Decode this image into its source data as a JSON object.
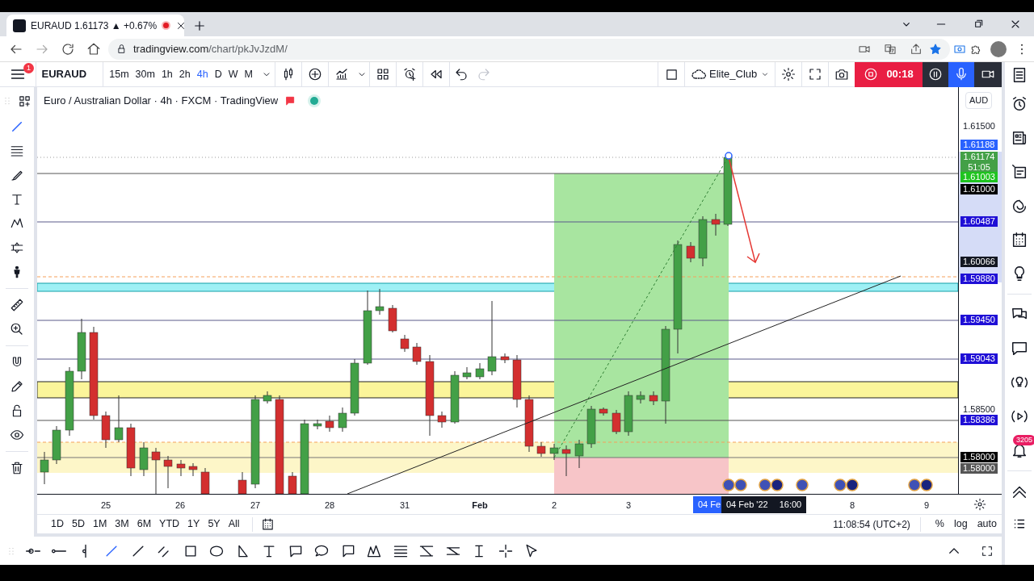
{
  "browser": {
    "tab_title": "EURAUD 1.61173 ▲ +0.67%",
    "url": {
      "host": "tradingview.com",
      "path": "/chart/pkJvJzdM/"
    }
  },
  "toolbar": {
    "menu_badge": "1",
    "symbol": "EURAUD",
    "intervals": [
      {
        "label": "15m",
        "selected": false
      },
      {
        "label": "30m",
        "selected": false
      },
      {
        "label": "1h",
        "selected": false
      },
      {
        "label": "2h",
        "selected": false
      },
      {
        "label": "4h",
        "selected": true
      },
      {
        "label": "D",
        "selected": false
      },
      {
        "label": "W",
        "selected": false
      },
      {
        "label": "M",
        "selected": false
      }
    ],
    "layout_name": "Elite_Club",
    "recorder_time": "00:18"
  },
  "legend": {
    "title": "Euro / Australian Dollar · 4h · FXCM · TradingView"
  },
  "price_axis": {
    "currency": "AUD",
    "labels": [
      {
        "text": "1.61500",
        "kind": "tick"
      },
      {
        "text": "1.61188",
        "kind": "marker",
        "color": "#2962ff"
      },
      {
        "text": "1.61174",
        "kind": "countdown",
        "countdown": "51:05",
        "color": "#43a047"
      },
      {
        "text": "1.61003",
        "kind": "marker",
        "color": "#1fc41f"
      },
      {
        "text": "1.61000",
        "kind": "marker",
        "color": "#000000"
      },
      {
        "text": "1.60487",
        "kind": "marker",
        "color": "#1f0fd6"
      },
      {
        "text": "1.60066",
        "kind": "marker",
        "color": "#131722"
      },
      {
        "text": "1.59880",
        "kind": "marker",
        "color": "#1f0fd6"
      },
      {
        "text": "1.59450",
        "kind": "marker",
        "color": "#1f0fd6"
      },
      {
        "text": "1.59043",
        "kind": "marker",
        "color": "#1f0fd6"
      },
      {
        "text": "1.58500",
        "kind": "tick"
      },
      {
        "text": "1.58386",
        "kind": "marker",
        "color": "#1f0fd6"
      },
      {
        "text": "1.58000",
        "kind": "marker",
        "color": "#000000"
      },
      {
        "text": "1.58000",
        "kind": "marker",
        "color": "#555555"
      }
    ]
  },
  "time_axis": {
    "labels": [
      {
        "text": "25",
        "kind": "day"
      },
      {
        "text": "26",
        "kind": "day"
      },
      {
        "text": "27",
        "kind": "day"
      },
      {
        "text": "28",
        "kind": "day"
      },
      {
        "text": "31",
        "kind": "day"
      },
      {
        "text": "Feb",
        "kind": "month"
      },
      {
        "text": "2",
        "kind": "day"
      },
      {
        "text": "3",
        "kind": "day"
      },
      {
        "text": "8",
        "kind": "day"
      },
      {
        "text": "9",
        "kind": "day"
      }
    ],
    "cursor_label": "04 Fe",
    "tooltip": {
      "date": "04 Feb '22",
      "time": "16:00"
    }
  },
  "bottom_bar": {
    "ranges": [
      "1D",
      "5D",
      "1M",
      "3M",
      "6M",
      "YTD",
      "1Y",
      "5Y",
      "All"
    ],
    "clock": "11:08:54 (UTC+2)",
    "scale_options": [
      "%",
      "log",
      "auto"
    ]
  },
  "sidebar": {
    "alerts_badge": "3205"
  }
}
